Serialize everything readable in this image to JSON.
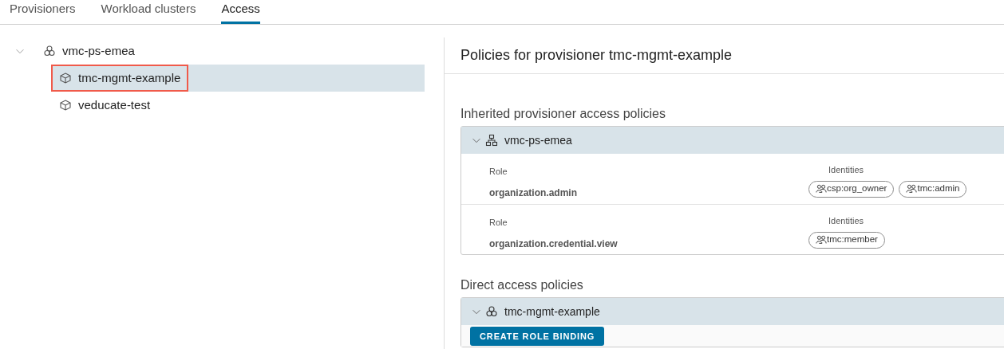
{
  "tabs": [
    {
      "label": "Provisioners",
      "selected": false
    },
    {
      "label": "Workload clusters",
      "selected": false
    },
    {
      "label": "Access",
      "selected": true
    }
  ],
  "tree": [
    {
      "label": "vmc-ps-emea",
      "kind": "cluster",
      "expanded": true,
      "selected": false,
      "highlighted": false,
      "children": [
        {
          "label": "tmc-mgmt-example",
          "kind": "box",
          "selected": true,
          "highlighted": true
        },
        {
          "label": "veducate-test",
          "kind": "box",
          "selected": false,
          "highlighted": false
        }
      ]
    }
  ],
  "panel": {
    "title": "Policies for provisioner tmc-mgmt-example",
    "sections": [
      {
        "heading": "Inherited provisioner access policies",
        "group": {
          "label": "vmc-ps-emea",
          "kind": "hierarchy",
          "expanded": true,
          "rows": [
            {
              "role_label": "Role",
              "role": "organization.admin",
              "identities_label": "Identities",
              "identities": [
                "csp:org_owner",
                "tmc:admin"
              ]
            },
            {
              "role_label": "Role",
              "role": "organization.credential.view",
              "identities_label": "Identities",
              "identities": [
                "tmc:member"
              ]
            }
          ]
        }
      },
      {
        "heading": "Direct access policies",
        "group": {
          "label": "tmc-mgmt-example",
          "kind": "cluster",
          "expanded": true,
          "button": "CREATE ROLE BINDING"
        }
      }
    ]
  }
}
